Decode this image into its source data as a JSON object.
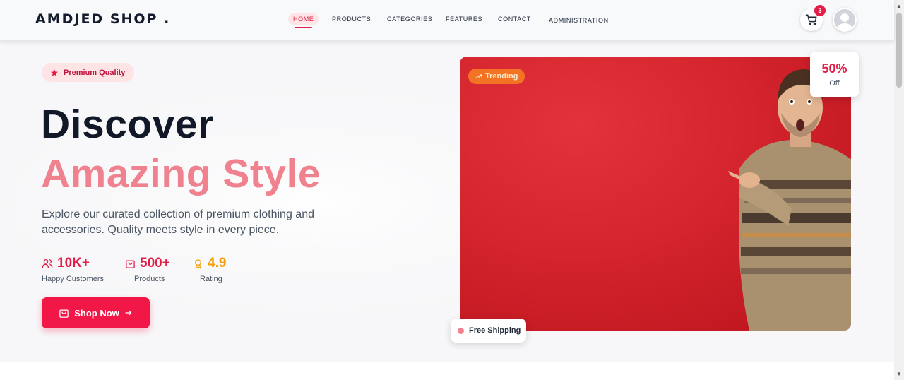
{
  "header": {
    "brand": "AMDJED SHOP .",
    "nav": [
      {
        "label": "HOME",
        "active": true
      },
      {
        "label": "PRODUCTS",
        "active": false
      },
      {
        "label": "CATEGORIES",
        "active": false
      },
      {
        "label": "FEATURES",
        "active": false
      },
      {
        "label": "CONTACT",
        "active": false
      },
      {
        "label": "ADMINISTRATION",
        "active": false
      }
    ],
    "cart_count": "3",
    "cart_icon": "cart-icon",
    "avatar_icon": "user-avatar-icon"
  },
  "hero": {
    "badge": "Premium Quality",
    "badge_icon": "star-icon",
    "title_line1": "Discover",
    "title_line2": "Amazing Style",
    "description": "Explore our curated collection of premium clothing and accessories. Quality meets style in every piece.",
    "stats": [
      {
        "value": "10K+",
        "label": "Happy Customers",
        "icon": "users-icon",
        "color": "#e11d48"
      },
      {
        "value": "500+",
        "label": "Products",
        "icon": "shopping-bag-icon",
        "color": "#e11d48"
      },
      {
        "value": "4.9",
        "label": "Rating",
        "icon": "award-icon",
        "color": "#f59e0b"
      }
    ],
    "cta_label": "Shop Now",
    "image": {
      "trending_label": "Trending",
      "discount_value": "50%",
      "discount_label": "Off",
      "shipping_label": "Free Shipping"
    }
  },
  "colors": {
    "accent": "#e11d48",
    "accent_light": "#f0828f",
    "rating": "#f59e0b",
    "hero_image_bg": "#d4242d"
  }
}
